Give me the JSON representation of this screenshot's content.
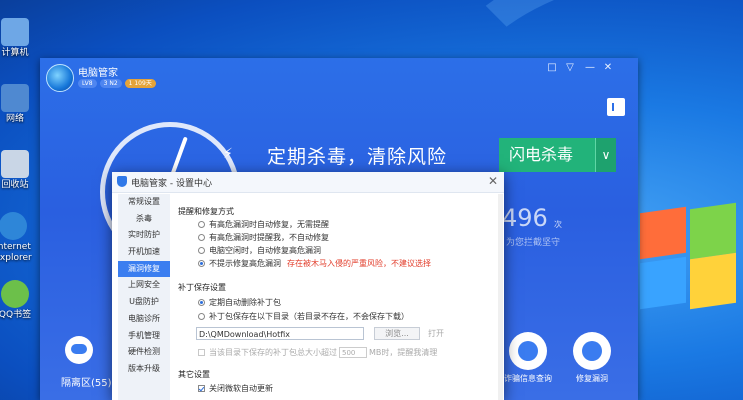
{
  "desktop": {
    "icons": [
      {
        "label": "计算机",
        "color": "#6ea7e6"
      },
      {
        "label": "网络",
        "color": "#4f89d1"
      },
      {
        "label": "回收站",
        "color": "#c9d6e6"
      },
      {
        "label": "Internet Explorer",
        "color": "#2e86d8"
      },
      {
        "label": "QQ书签",
        "color": "#6cc04a"
      }
    ]
  },
  "app": {
    "title": "电脑管家",
    "badges": [
      "LV8",
      "3 N2",
      "1 109天"
    ],
    "window_controls": [
      "□",
      "▽",
      "—",
      "✕"
    ],
    "slogan": "定期杀毒，清除风险",
    "flash_button": "闪电杀毒",
    "flash_dropdown": "∨",
    "days_number": "496",
    "days_unit": "次",
    "days_caption": "为您拦截坚守",
    "bottom_left": "隔离区(55)",
    "tools": [
      {
        "label": "诈骗信息查询"
      },
      {
        "label": "修复漏洞"
      }
    ]
  },
  "settings": {
    "title": "电脑管家 - 设置中心",
    "close": "✕",
    "sidebar": [
      "常规设置",
      "杀毒",
      "实时防护",
      "开机加速",
      "漏洞修复",
      "上网安全",
      "U盘防护",
      "电脑诊所",
      "手机管理",
      "硬件检测",
      "版本升级"
    ],
    "active_index": 4,
    "section1": {
      "title": "提醒和修复方式",
      "options": [
        "有高危漏洞时自动修复，无需提醒",
        "有高危漏洞时提醒我，不自动修复",
        "电脑空闲时，自动修复高危漏洞",
        "不提示修复高危漏洞"
      ],
      "selected": 3,
      "warning": "存在被木马入侵的严重风险，不建议选择"
    },
    "section2": {
      "title": "补丁保存设置",
      "options": [
        "定期自动删除补丁包",
        "补丁包保存在以下目录（若目录不存在，不会保存下载）"
      ],
      "selected": 0,
      "path": "D:\\QMDownload\\Hotfix",
      "browse": "浏览...",
      "open": "打开",
      "size_prefix": "当该目录下保存的补丁包总大小超过",
      "size_value": "500",
      "size_suffix": "MB时，提醒我清理"
    },
    "section3": {
      "title": "其它设置",
      "options": [
        "关闭微软自动更新"
      ]
    }
  }
}
